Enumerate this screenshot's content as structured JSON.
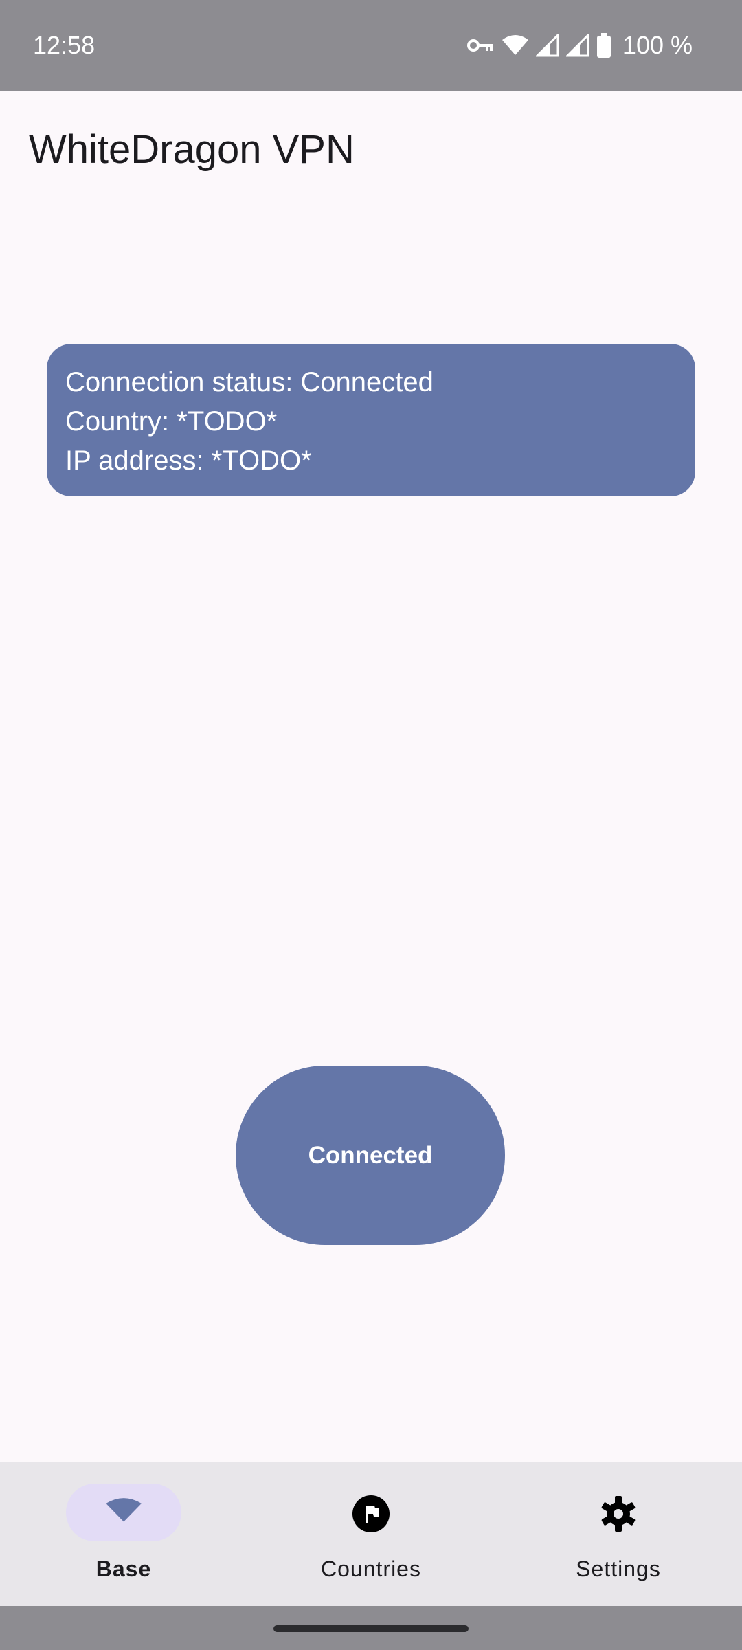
{
  "status_bar": {
    "time": "12:58",
    "battery_text": "100 %",
    "icons": [
      "vpn-key-icon",
      "wifi-icon",
      "signal-icon",
      "signal-icon",
      "battery-icon"
    ]
  },
  "app": {
    "title": "WhiteDragon VPN"
  },
  "info_card": {
    "status_line": "Connection status: Connected",
    "country_line": "Country: *TODO*",
    "ip_line": "IP address: *TODO*"
  },
  "connect_button": {
    "label": "Connected"
  },
  "bottom_nav": {
    "items": [
      {
        "label": "Base",
        "icon": "wifi-icon",
        "active": true
      },
      {
        "label": "Countries",
        "icon": "flag-icon",
        "active": false
      },
      {
        "label": "Settings",
        "icon": "gear-icon",
        "active": false
      }
    ]
  },
  "colors": {
    "accent": "#6476a8",
    "background": "#fcf8fb",
    "status_bar": "#8d8c91",
    "nav_background": "#e8e6ea",
    "nav_active_pill": "#e3dcf6"
  }
}
